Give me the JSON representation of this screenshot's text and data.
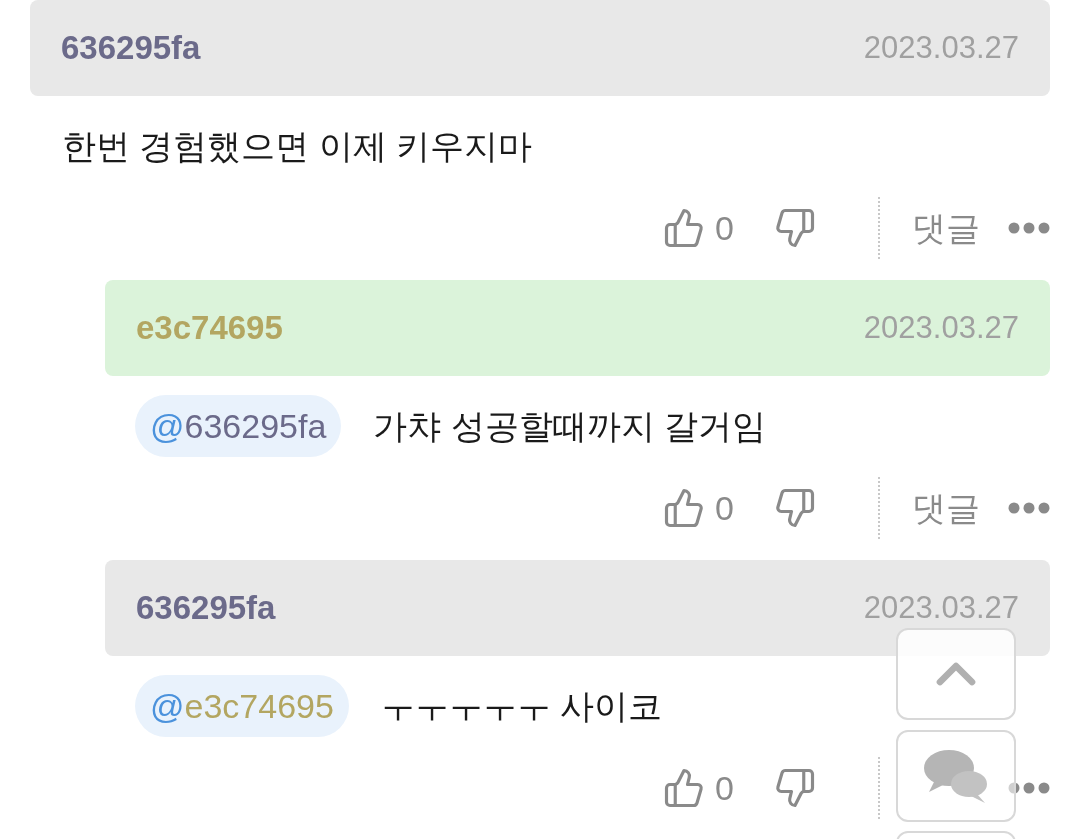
{
  "comments": [
    {
      "author": "636295fa",
      "color": "#6b6a8a",
      "highlighted": false,
      "date": "2023.03.27",
      "indent": false,
      "text": "한번 경험했으면 이제 키우지마",
      "likes": "0",
      "reply_label": "댓글"
    },
    {
      "author": "e3c74695",
      "color": "#b3a661",
      "highlighted": true,
      "date": "2023.03.27",
      "indent": true,
      "mention": {
        "at": "@",
        "name": "636295fa",
        "color": "#6b6a8a"
      },
      "text": "가챠 성공할때까지 갈거임",
      "likes": "0",
      "reply_label": "댓글"
    },
    {
      "author": "636295fa",
      "color": "#6b6a8a",
      "highlighted": false,
      "date": "2023.03.27",
      "indent": true,
      "mention": {
        "at": "@",
        "name": "e3c74695",
        "color": "#b3a661"
      },
      "text": "ㅜㅜㅜㅜㅜ 사이코",
      "likes": "0"
    }
  ]
}
